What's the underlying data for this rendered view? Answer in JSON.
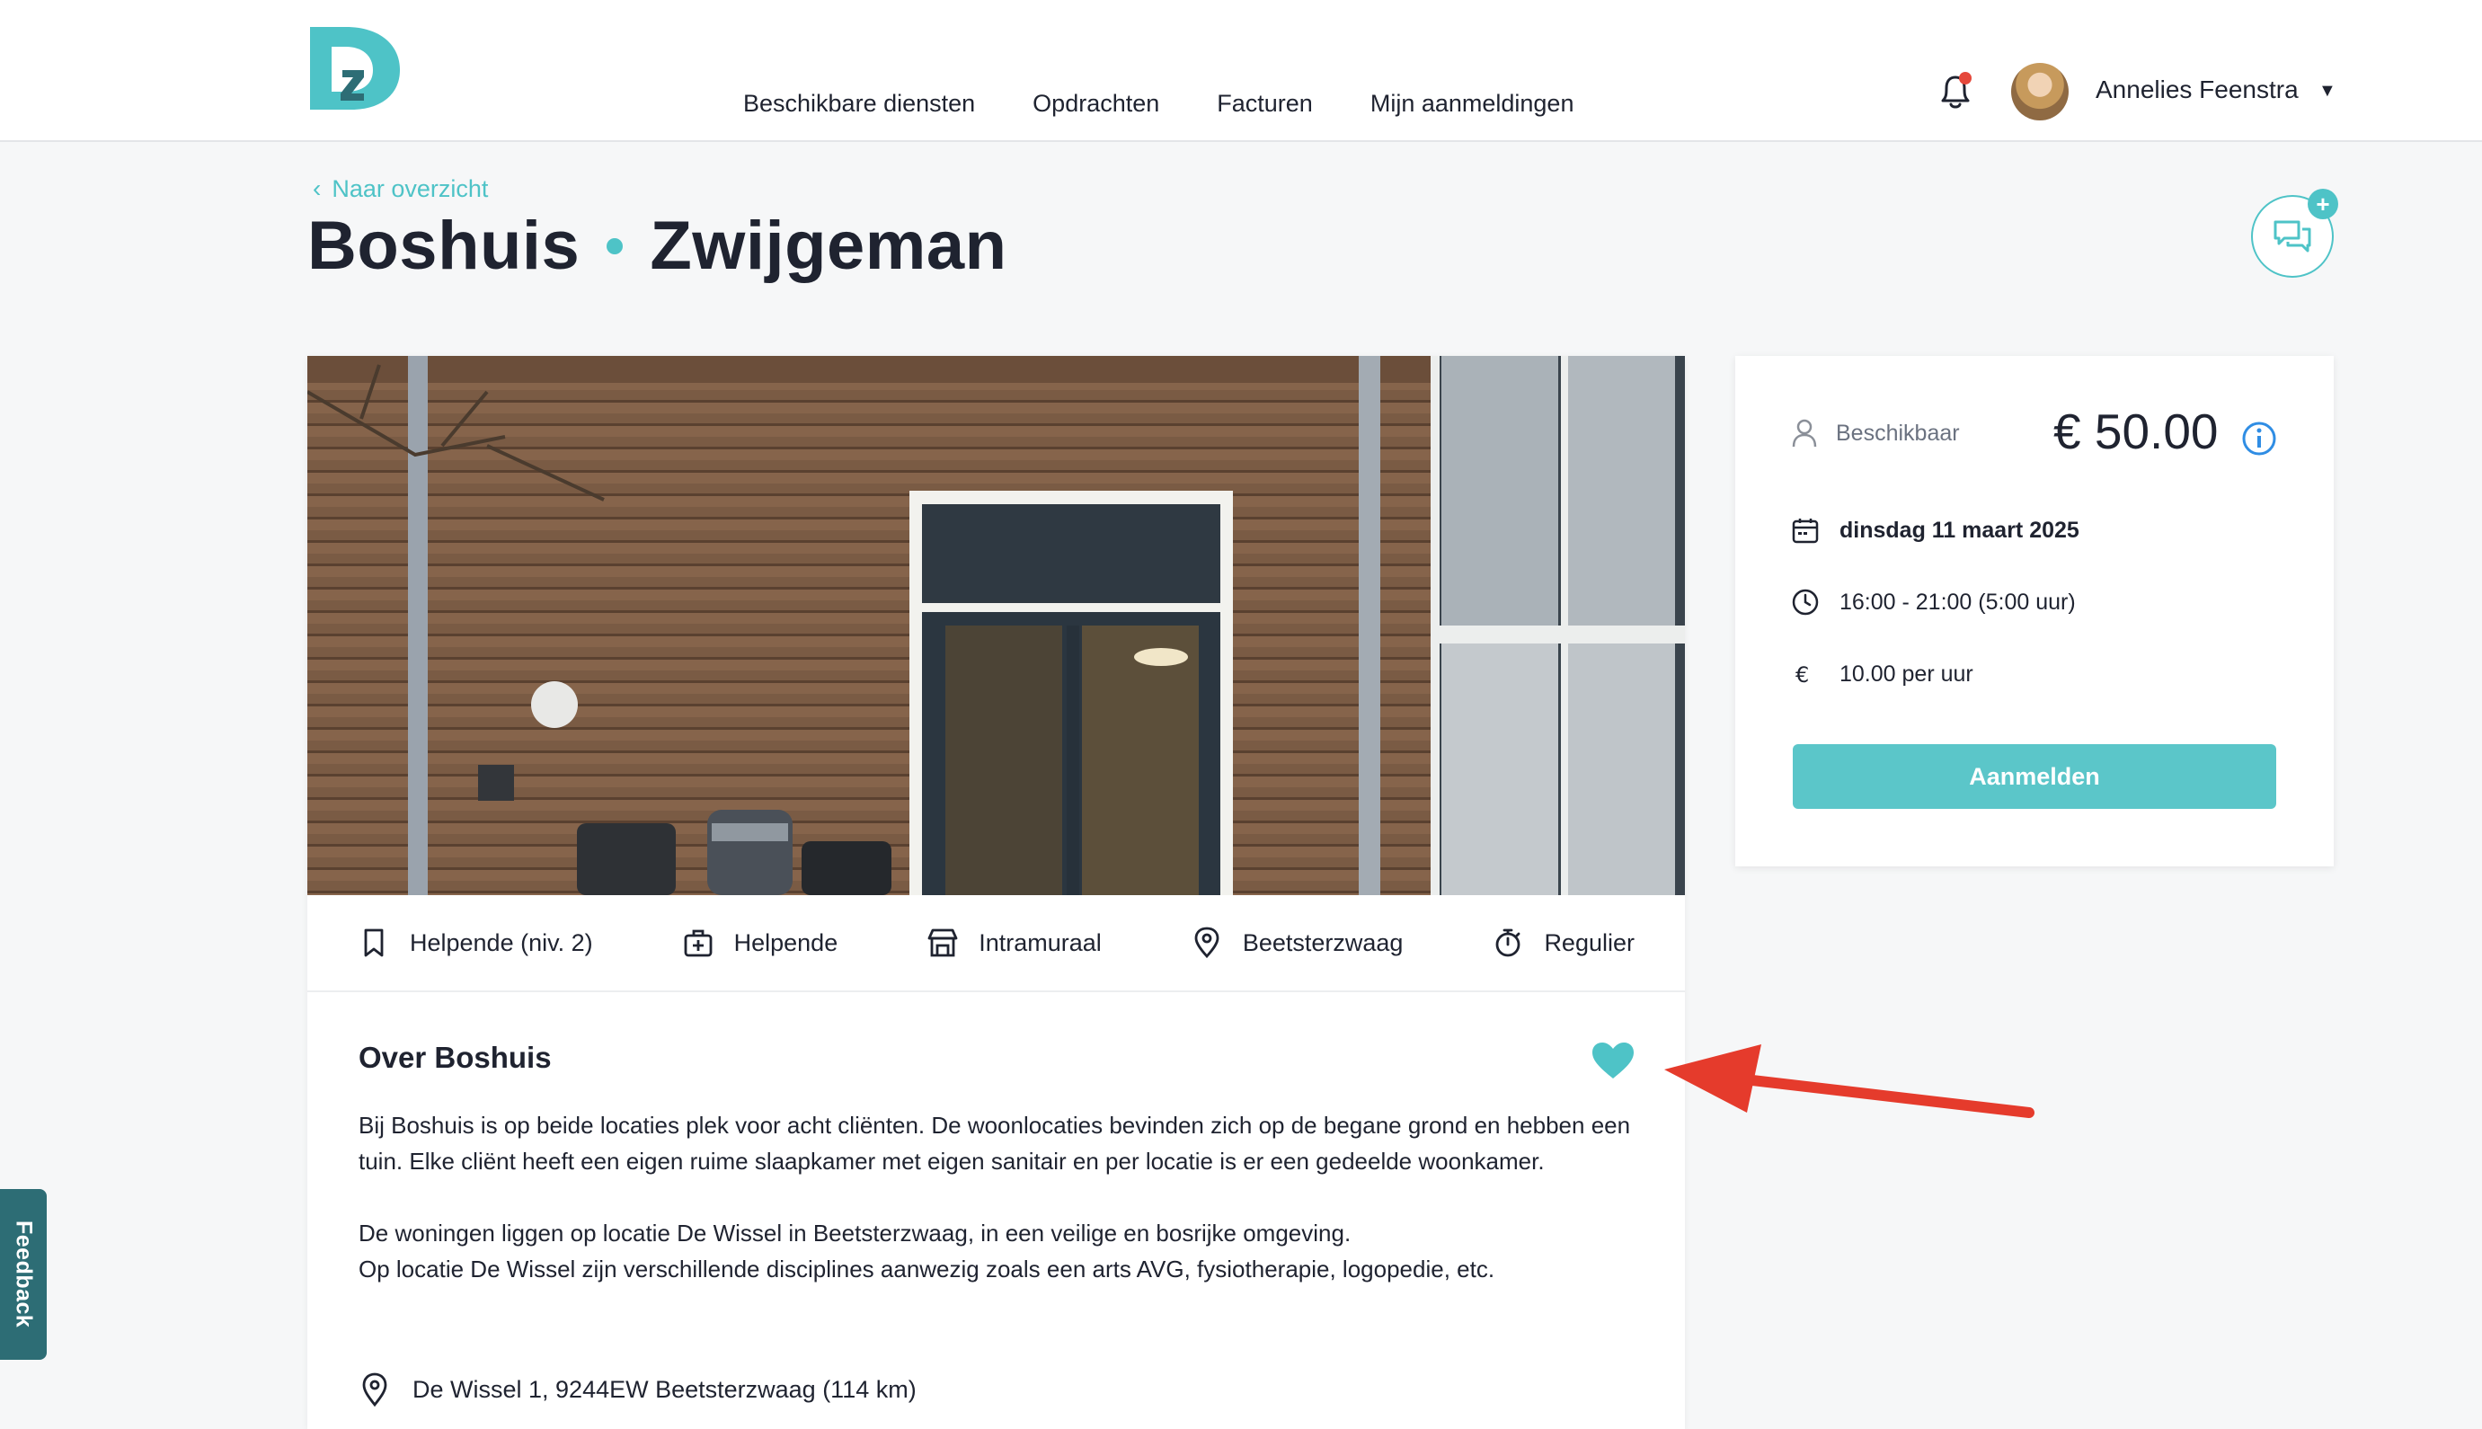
{
  "header": {
    "nav": [
      {
        "label": "Beschikbare diensten"
      },
      {
        "label": "Opdrachten"
      },
      {
        "label": "Facturen"
      },
      {
        "label": "Mijn aanmeldingen"
      }
    ],
    "user_name": "Annelies Feenstra",
    "bell_icon": "bell-icon",
    "has_notification": true
  },
  "page": {
    "back_label": "Naar overzicht",
    "title_part1": "Boshuis",
    "title_part2": "Zwijgeman"
  },
  "tags": [
    {
      "icon": "bookmark-icon",
      "label": "Helpende (niv. 2)"
    },
    {
      "icon": "medical-bag-icon",
      "label": "Helpende"
    },
    {
      "icon": "building-icon",
      "label": "Intramuraal"
    },
    {
      "icon": "location-pin-icon",
      "label": "Beetsterzwaag"
    },
    {
      "icon": "stopwatch-icon",
      "label": "Regulier"
    }
  ],
  "about": {
    "title": "Over Boshuis",
    "paragraph1": "Bij Boshuis is op beide locaties plek voor acht cliënten. De woonlocaties bevinden zich op de begane grond en hebben een tuin. Elke cliënt heeft een eigen ruime slaapkamer met eigen sanitair en per locatie is er een gedeelde woonkamer.",
    "paragraph2_line1": "De woningen liggen op locatie De Wissel in Beetsterzwaag, in een veilige en bosrijke omgeving.",
    "paragraph2_line2": "Op locatie De Wissel zijn verschillende disciplines aanwezig zoals een arts AVG, fysiotherapie, logopedie, etc.",
    "address": "De Wissel 1, 9244EW Beetsterzwaag (114 km)"
  },
  "shift": {
    "status": "Beschikbaar",
    "price": "€ 50.00",
    "date": "dinsdag 11 maart 2025",
    "time": "16:00 - 21:00 (5:00 uur)",
    "rate": "10.00 per uur",
    "button_label": "Aanmelden"
  },
  "feedback_label": "Feedback",
  "colors": {
    "accent": "#4ec3c7",
    "button": "#5bc6c9",
    "feedback_tab": "#2d6d75",
    "annotation_arrow": "#e53b2c",
    "notification_dot": "#e5483b"
  }
}
